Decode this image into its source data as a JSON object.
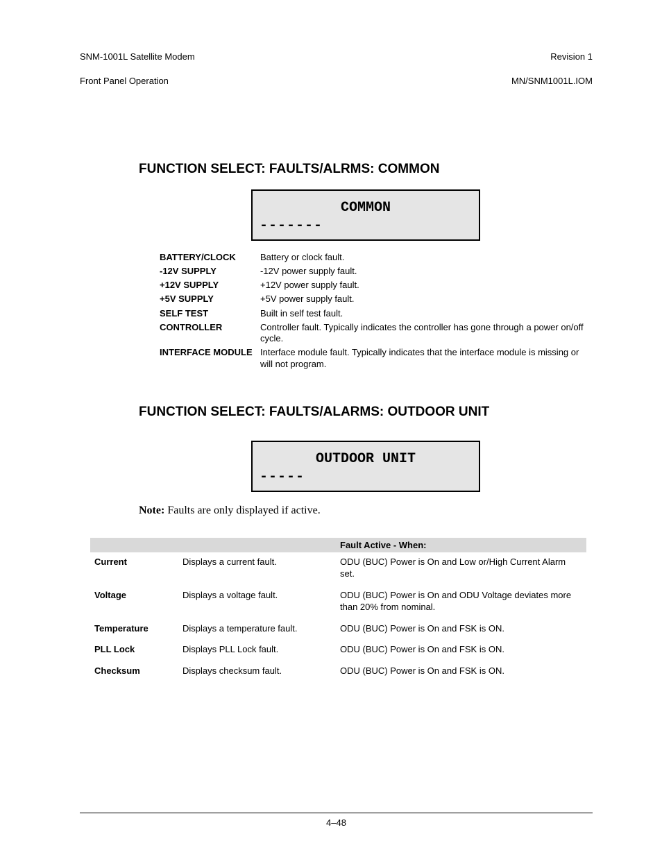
{
  "header": {
    "left_line1": "SNM-1001L Satellite Modem",
    "left_line2": "Front Panel Operation",
    "right_line1": "Revision 1",
    "right_line2": "MN/SNM1001L.IOM"
  },
  "section1": {
    "title": "FUNCTION SELECT: FAULTS/ALRMS: COMMON",
    "lcd_main": "COMMON",
    "lcd_sub": "-------",
    "rows": [
      {
        "term": "BATTERY/CLOCK",
        "desc": "Battery or clock fault."
      },
      {
        "term": "-12V SUPPLY",
        "desc": "-12V power supply fault."
      },
      {
        "term": "+12V SUPPLY",
        "desc": "+12V power supply fault."
      },
      {
        "term": "+5V SUPPLY",
        "desc": "+5V power supply fault."
      },
      {
        "term": "SELF TEST",
        "desc": "Built in self test fault."
      },
      {
        "term": "CONTROLLER",
        "desc": "Controller fault. Typically indicates the controller has gone through a power on/off cycle."
      },
      {
        "term": "INTERFACE MODULE",
        "desc": "Interface module fault. Typically indicates that the interface module is missing or will not program."
      }
    ]
  },
  "section2": {
    "title": "FUNCTION SELECT: FAULTS/ALARMS: OUTDOOR UNIT",
    "lcd_main": "OUTDOOR UNIT",
    "lcd_sub": "-----",
    "note_label": "Note:",
    "note_text": " Faults are only displayed if active.",
    "table_header_col3": "Fault Active  - When:",
    "rows": [
      {
        "term": "Current",
        "col2": "Displays a current fault.",
        "col3": "ODU (BUC) Power is On and Low or/High Current Alarm set."
      },
      {
        "term": "Voltage",
        "col2": "Displays a voltage fault.",
        "col3": "ODU (BUC) Power is On and ODU Voltage deviates more than 20% from nominal."
      },
      {
        "term": "Temperature",
        "col2": "Displays a temperature fault.",
        "col3": "ODU (BUC) Power is On and FSK is ON."
      },
      {
        "term": "PLL Lock",
        "col2": "Displays PLL Lock fault.",
        "col3": "ODU (BUC) Power is On and FSK is ON."
      },
      {
        "term": "Checksum",
        "col2": "Displays checksum fault.",
        "col3": "ODU (BUC) Power is On and FSK is ON."
      }
    ]
  },
  "footer": {
    "page": "4–48"
  }
}
